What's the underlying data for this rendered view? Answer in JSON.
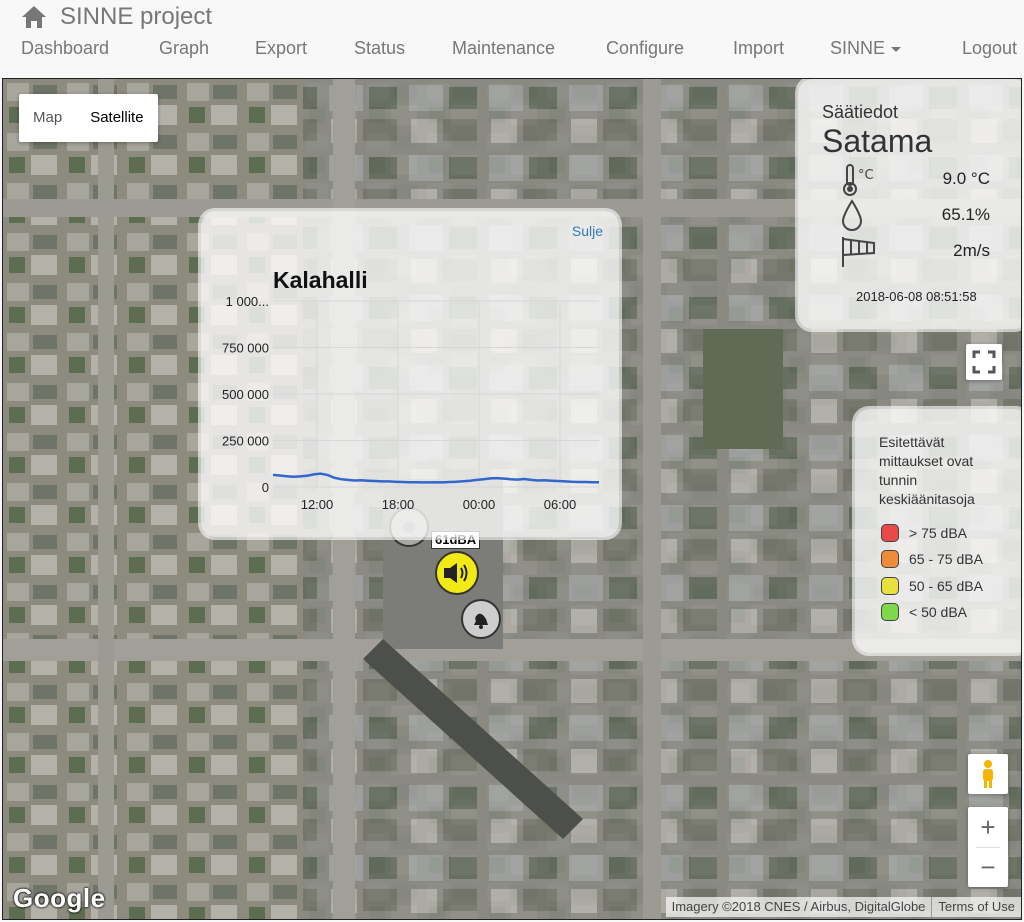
{
  "navbar": {
    "brand": "SINNE project",
    "items": [
      {
        "label": "Dashboard"
      },
      {
        "label": "Graph"
      },
      {
        "label": "Export"
      },
      {
        "label": "Status"
      },
      {
        "label": "Maintenance"
      },
      {
        "label": "Configure"
      },
      {
        "label": "Import"
      },
      {
        "label": "SINNE"
      },
      {
        "label": "Logout"
      }
    ],
    "home_icon": "home-icon"
  },
  "map": {
    "type_control": {
      "map_label": "Map",
      "satellite_label": "Satellite",
      "selected": "Satellite"
    },
    "logo": "Google",
    "attribution": "Imagery ©2018 CNES / Airbus, DigitalGlobe",
    "terms": "Terms of Use",
    "zoom_in": "+",
    "zoom_out": "−"
  },
  "weather": {
    "heading": "Säätiedot",
    "location": "Satama",
    "temperature": "9.0 °C",
    "humidity": "65.1%",
    "wind": "2m/s",
    "timestamp": "2018-06-08 08:51:58"
  },
  "legend": {
    "note": "Esitettävät mittaukset ovat tunnin keskiäänitasoja",
    "items": [
      {
        "label": "> 75 dBA",
        "color": "#e84a4a"
      },
      {
        "label": "65 - 75 dBA",
        "color": "#ee8c3a"
      },
      {
        "label": "50 - 65 dBA",
        "color": "#e8e040"
      },
      {
        "label": "< 50 dBA",
        "color": "#7ed84a"
      }
    ]
  },
  "marker": {
    "label": "61dBA",
    "color": "#f2ea16"
  },
  "popup": {
    "close_label": "Sulje",
    "title": "Kalahalli"
  },
  "chart_data": {
    "type": "line",
    "title": "Kalahalli",
    "xlabel": "",
    "ylabel": "",
    "x_ticks": [
      "12:00",
      "18:00",
      "00:00",
      "06:00"
    ],
    "y_ticks": [
      "0",
      "250 000",
      "500 000",
      "750 000",
      "1 000..."
    ],
    "ylim": [
      0,
      1000000
    ],
    "grid": true,
    "series": [
      {
        "color": "#3366cc",
        "x": [
          0,
          0.5,
          1,
          1.5,
          2,
          2.5,
          3,
          3.5,
          4,
          4.5,
          5,
          5.5,
          6,
          6.5,
          7,
          7.5,
          8,
          8.5,
          9,
          9.5,
          10,
          10.5,
          11,
          11.5,
          12,
          12.5,
          13,
          13.5,
          14,
          14.5,
          15,
          15.5,
          16,
          16.5,
          17,
          17.5,
          18,
          18.5,
          19,
          19.5,
          20,
          20.5,
          21,
          21.5,
          22,
          22.5,
          23,
          23.5,
          24
        ],
        "values": [
          65000,
          62000,
          58000,
          55000,
          57000,
          60000,
          68000,
          72000,
          65000,
          50000,
          42000,
          38000,
          35000,
          36000,
          34000,
          32000,
          30000,
          30000,
          28000,
          27000,
          26000,
          26000,
          25000,
          25000,
          26000,
          25000,
          27000,
          28000,
          31000,
          34000,
          38000,
          42000,
          46000,
          48000,
          45000,
          42000,
          40000,
          43000,
          38000,
          35000,
          36000,
          34000,
          32000,
          30000,
          28000,
          27000,
          27000,
          26000,
          26000
        ]
      }
    ]
  }
}
